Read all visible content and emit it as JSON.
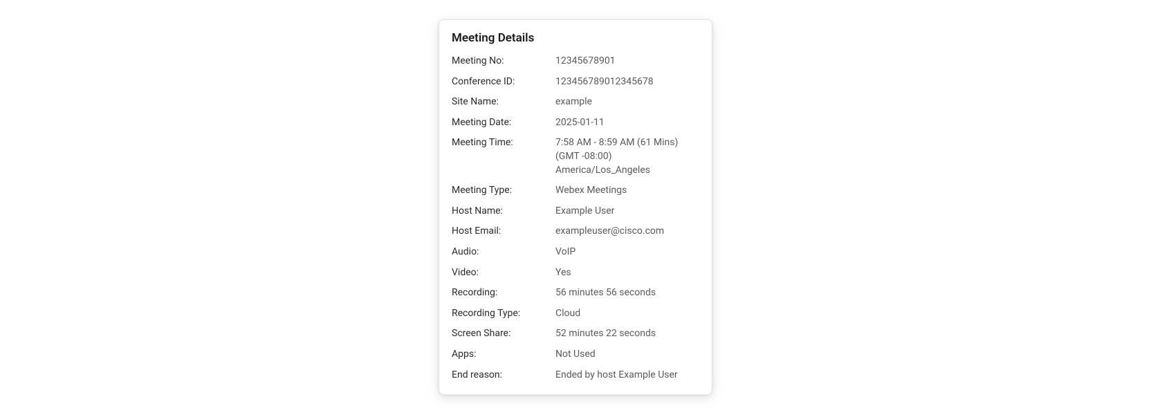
{
  "title": "Meeting Details",
  "rows": [
    {
      "label": "Meeting No:",
      "value": "12345678901"
    },
    {
      "label": "Conference ID:",
      "value": "123456789012345678"
    },
    {
      "label": "Site Name:",
      "value": "example"
    },
    {
      "label": "Meeting Date:",
      "value": "2025-01-11"
    },
    {
      "label": "Meeting Time:",
      "value": "7:58 AM - 8:59 AM (61 Mins) (GMT -08:00) America/Los_Angeles"
    },
    {
      "label": "Meeting Type:",
      "value": "Webex Meetings"
    },
    {
      "label": "Host Name:",
      "value": "Example User"
    },
    {
      "label": "Host Email:",
      "value": "exampleuser@cisco.com"
    },
    {
      "label": "Audio:",
      "value": "VoIP"
    },
    {
      "label": "Video:",
      "value": "Yes"
    },
    {
      "label": "Recording:",
      "value": "56 minutes 56 seconds"
    },
    {
      "label": "Recording Type:",
      "value": "Cloud"
    },
    {
      "label": "Screen Share:",
      "value": "52 minutes 22 seconds"
    },
    {
      "label": "Apps:",
      "value": "Not Used"
    },
    {
      "label": "End reason:",
      "value": "Ended by host Example User"
    }
  ]
}
